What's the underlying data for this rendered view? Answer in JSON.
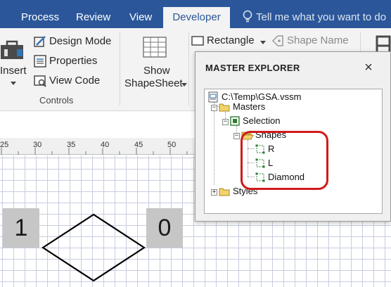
{
  "tabs": [
    {
      "label": "Process",
      "active": false
    },
    {
      "label": "Review",
      "active": false
    },
    {
      "label": "View",
      "active": false
    },
    {
      "label": "Developer",
      "active": true
    }
  ],
  "tell_me": "Tell me what you want to do",
  "ribbon": {
    "insert_label": "Insert",
    "design_mode": "Design Mode",
    "properties": "Properties",
    "view_code": "View Code",
    "controls_group": "Controls",
    "show_shapesheet_line1": "Show",
    "show_shapesheet_line2": "ShapeSheet",
    "rectangle": "Rectangle",
    "shape_name": "Shape Name"
  },
  "ruler": {
    "ticks": [
      "25",
      "30",
      "35",
      "40",
      "45",
      "50"
    ]
  },
  "canvas": {
    "left_box": "1",
    "right_box": "0"
  },
  "master_explorer": {
    "title": "MASTER EXPLORER",
    "close_symbol": "×",
    "tree": {
      "root": "C:\\Temp\\GSA.vssm",
      "masters": "Masters",
      "selection": "Selection",
      "shapes": "Shapes",
      "shape_items": [
        "R",
        "L",
        "Diamond"
      ],
      "styles": "Styles"
    }
  },
  "colors": {
    "ribbon_blue": "#2b579a",
    "highlight_red": "#d11a1a",
    "folder_yellow": "#f2d36b"
  }
}
